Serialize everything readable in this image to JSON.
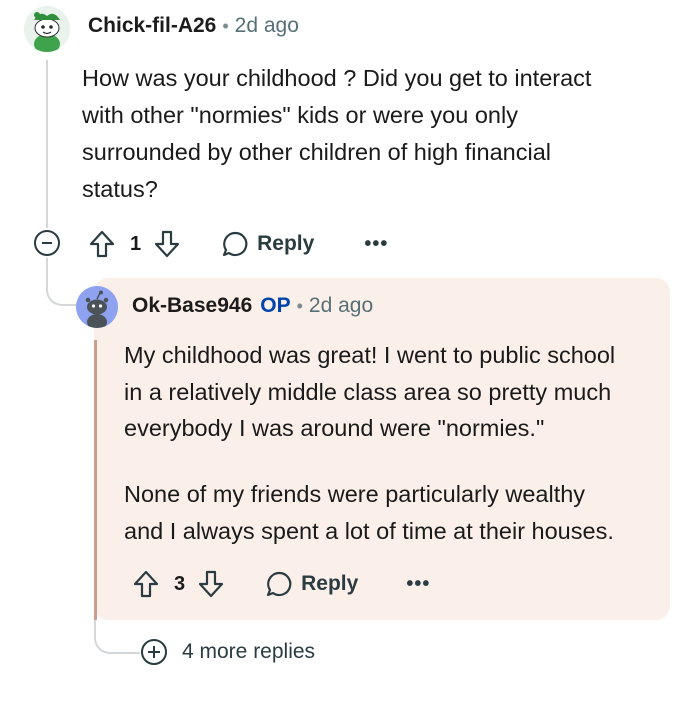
{
  "comment": {
    "author": "Chick-fil-A26",
    "time": "2d ago",
    "body": "How was your childhood ? Did you get to interact with other \"normies\" kids or were you only surrounded by other children of high financial status?",
    "body_lines": [
      "How was your childhood ? Did you get to interact",
      "with other \"normies\" kids or were you only",
      "surrounded by other children of high financial",
      "status?"
    ],
    "score": "1",
    "reply_label": "Reply",
    "more_label": "•••"
  },
  "reply": {
    "author": "Ok-Base946",
    "op_tag": "OP",
    "time": "2d ago",
    "paragraph1_lines": [
      "My childhood was great! I went to public school",
      "in a relatively middle class area so pretty much",
      "everybody I was around were \"normies.\""
    ],
    "paragraph2_lines": [
      "None of my friends were particularly wealthy",
      "and I always spent a lot of time at their houses."
    ],
    "score": "3",
    "reply_label": "Reply",
    "more_label": "•••"
  },
  "more_replies": {
    "label": "4 more replies"
  },
  "colors": {
    "reply_background": "#fbefea",
    "op_tag": "#0045ac",
    "thread_line": "#d4d7d9",
    "highlight_bar": "#c9a08e"
  },
  "icons": [
    "avatar-snoo-green",
    "avatar-snoo-blue",
    "collapse-icon",
    "upvote-icon",
    "downvote-icon",
    "comment-bubble-icon",
    "expand-plus-icon"
  ]
}
